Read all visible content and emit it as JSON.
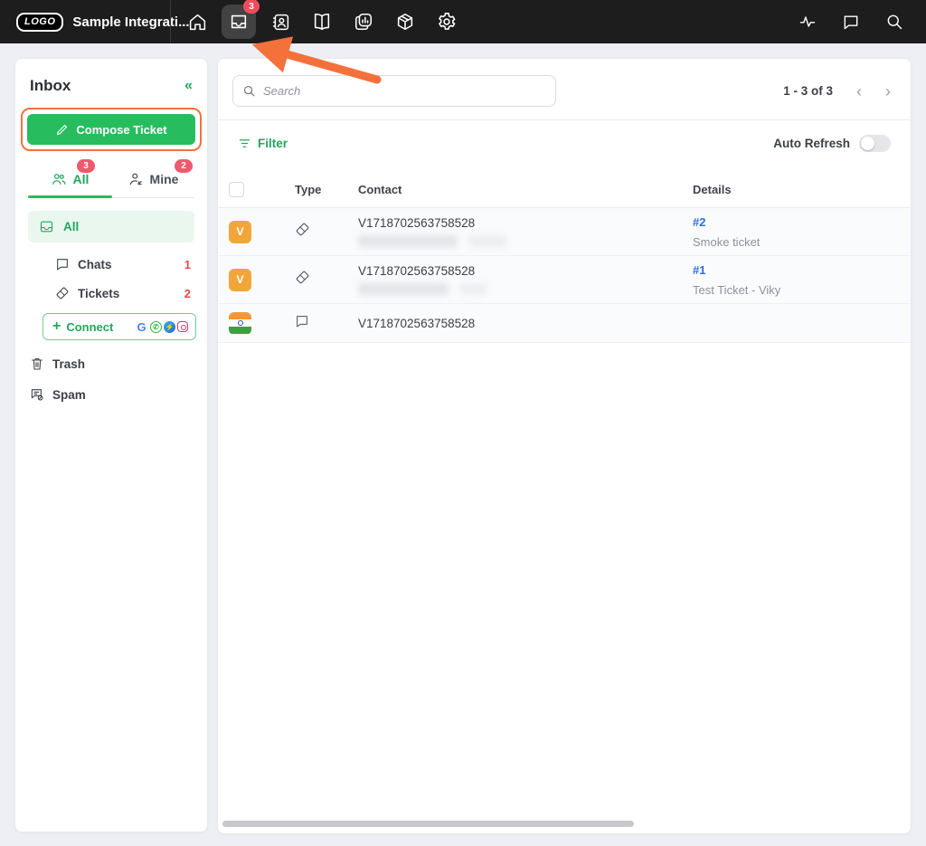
{
  "topbar": {
    "logo_text": "LOGO",
    "app_title": "Sample Integrati...",
    "inbox_badge_count": "3"
  },
  "sidebar": {
    "title": "Inbox",
    "collapse_glyph": "«",
    "compose_label": "Compose Ticket",
    "tabs": {
      "all": {
        "label": "All",
        "count": "3"
      },
      "mine": {
        "label": "Mine",
        "count": "2"
      }
    },
    "folders": {
      "all": {
        "label": "All"
      },
      "chats": {
        "label": "Chats",
        "count": "1"
      },
      "tickets": {
        "label": "Tickets",
        "count": "2"
      }
    },
    "connect": {
      "plus": "+",
      "label": "Connect"
    },
    "trash_label": "Trash",
    "spam_label": "Spam"
  },
  "main": {
    "search_placeholder": "Search",
    "pagination": {
      "text": "1 - 3 of 3",
      "prev": "‹",
      "next": "›"
    },
    "filter_label": "Filter",
    "auto_refresh_label": "Auto Refresh",
    "table": {
      "columns": {
        "type": "Type",
        "contact": "Contact",
        "details": "Details"
      },
      "rows": [
        {
          "avatar_initial": "V",
          "avatar_kind": "initial-orange",
          "type": "ticket",
          "contact": "V1718702563758528",
          "contact_redacted": true,
          "detail_id": "#2",
          "detail_text": "Smoke ticket"
        },
        {
          "avatar_initial": "V",
          "avatar_kind": "initial-orange",
          "type": "ticket",
          "contact": "V1718702563758528",
          "contact_redacted": true,
          "detail_id": "#1",
          "detail_text": "Test Ticket - Viky"
        },
        {
          "avatar_initial": "",
          "avatar_kind": "india-flag",
          "type": "chat",
          "contact": "V1718702563758528",
          "contact_redacted": false,
          "detail_id": "",
          "detail_text": ""
        }
      ]
    }
  },
  "colors": {
    "accent_green": "#27bd5e",
    "green_text": "#1fa85c",
    "annotation_orange": "#f4713c",
    "badge_red": "#ee4d5f",
    "count_red": "#e8474b",
    "link_blue": "#2d6ce8",
    "avatar_orange": "#f2a638",
    "topbar_bg": "#1d1d1d"
  }
}
